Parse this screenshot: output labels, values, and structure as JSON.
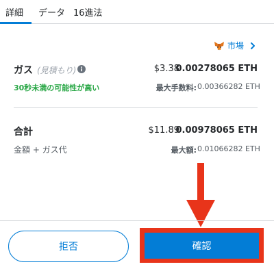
{
  "tabs": [
    {
      "label": "詳細",
      "active": true
    },
    {
      "label": "データ",
      "active": false
    },
    {
      "label": "16進法",
      "active": false
    }
  ],
  "market": {
    "label": "市場",
    "icon": "metamask-fox-icon"
  },
  "gas": {
    "label": "ガス",
    "estimate_label": "(見積もり)",
    "fiat": "$3.38",
    "eth": "0.00278065 ETH",
    "speed_text": "30秒未満の可能性が高い",
    "max_fee_label": "最大手数料:",
    "max_fee_value": "0.00366282 ETH"
  },
  "total": {
    "label": "合計",
    "fiat": "$11.89",
    "eth": "0.00978065 ETH",
    "sub_label": "金額 + ガス代",
    "max_amount_label": "最大額:",
    "max_amount_value": "0.01066282 ETH"
  },
  "buttons": {
    "reject": "拒否",
    "confirm": "確認"
  },
  "colors": {
    "accent": "#037dd6",
    "success": "#28a745",
    "annotation": "#e8341a"
  }
}
